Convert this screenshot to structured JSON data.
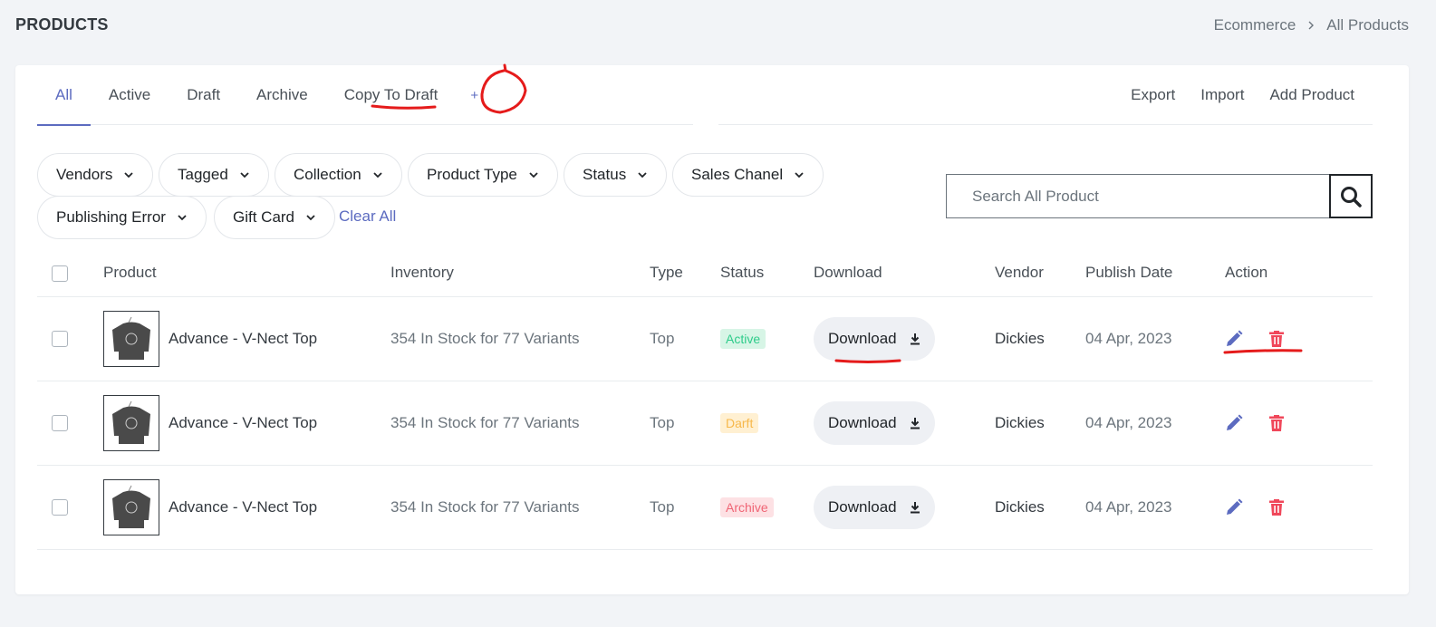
{
  "header": {
    "title": "PRODUCTS",
    "breadcrumb": [
      "Ecommerce",
      "All Products"
    ]
  },
  "tabs": [
    {
      "label": "All",
      "active": true
    },
    {
      "label": "Active",
      "active": false
    },
    {
      "label": "Draft",
      "active": false
    },
    {
      "label": "Archive",
      "active": false
    },
    {
      "label": "Copy To Draft",
      "active": false
    }
  ],
  "add_tab_label": "+",
  "actions": {
    "export": "Export",
    "import": "Import",
    "add_product": "Add Product"
  },
  "filters": {
    "vendors": "Vendors",
    "tagged": "Tagged",
    "collection": "Collection",
    "product_type": "Product Type",
    "status": "Status",
    "sales_channel": "Sales Chanel",
    "publishing_error": "Publishing Error",
    "gift_card": "Gift Card",
    "clear_all": "Clear All"
  },
  "search": {
    "placeholder": "Search All Product"
  },
  "table": {
    "headers": {
      "product": "Product",
      "inventory": "Inventory",
      "type": "Type",
      "status": "Status",
      "download": "Download",
      "vendor": "Vendor",
      "publish_date": "Publish Date",
      "action": "Action"
    },
    "rows": [
      {
        "product": "Advance - V-Nect Top",
        "inventory": "354 In Stock for 77 Variants",
        "type": "Top",
        "status": "Active",
        "download": "Download",
        "vendor": "Dickies",
        "publish_date": "04 Apr, 2023"
      },
      {
        "product": "Advance - V-Nect Top",
        "inventory": "354 In Stock for 77 Variants",
        "type": "Top",
        "status": "Darft",
        "download": "Download",
        "vendor": "Dickies",
        "publish_date": "04 Apr, 2023"
      },
      {
        "product": "Advance - V-Nect Top",
        "inventory": "354 In Stock for 77 Variants",
        "type": "Top",
        "status": "Archive",
        "download": "Download",
        "vendor": "Dickies",
        "publish_date": "04 Apr, 2023"
      }
    ]
  },
  "colors": {
    "accent": "#5c6bc0",
    "delete": "#f0475a",
    "annotation": "#e51b1b"
  }
}
